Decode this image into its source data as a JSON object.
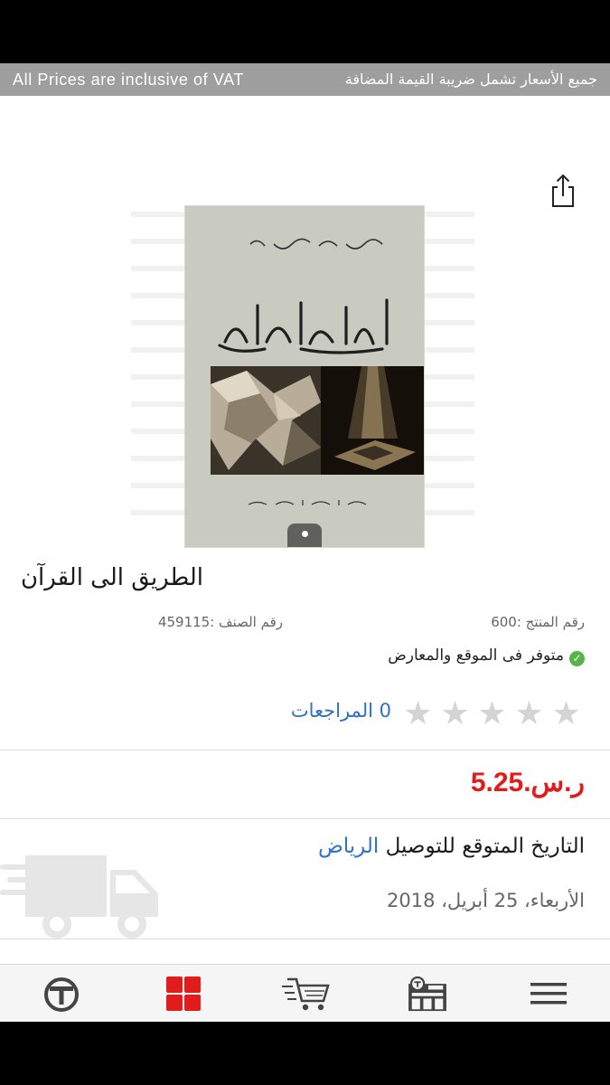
{
  "vat_bar": {
    "english": "All Prices are inclusive of VAT",
    "arabic": "جميع الأسعار تشمل ضريبة القيمة المضافة"
  },
  "product": {
    "title": "الطريق الى القرآن",
    "sku_text": "رقم المنتج :600",
    "category_text": "رقم الصنف :459115",
    "availability": "متوفر فى الموقع والمعارض",
    "rating": 0,
    "rating_max": 5,
    "reviews_text": "0 المراجعات",
    "price": "ر.س.5.25"
  },
  "delivery": {
    "label": "التاريخ المتوقع للتوصيل",
    "city": "الرياض",
    "date": "الأربعاء، 25 أبريل، 2018"
  },
  "image_carousel": {
    "count": 1,
    "current": 1
  },
  "tabbar": {
    "items": [
      {
        "icon": "logo-icon",
        "selected": false
      },
      {
        "icon": "categories-grid-icon",
        "selected": true
      },
      {
        "icon": "cart-icon",
        "selected": false
      },
      {
        "icon": "stores-icon",
        "selected": false
      },
      {
        "icon": "menu-icon",
        "selected": false
      }
    ]
  },
  "colors": {
    "accent_red": "#e21b1b",
    "link_blue": "#2f70c8",
    "available_green": "#55b44a",
    "vat_bar_gray": "#9e9e9e"
  }
}
